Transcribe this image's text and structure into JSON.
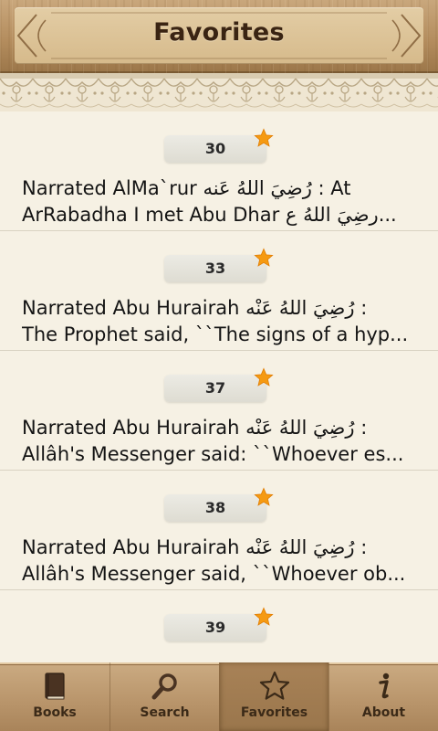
{
  "header": {
    "title": "Favorites"
  },
  "favorites": [
    {
      "number": "30",
      "line1": "Narrated AlMa`rur رُضِيَ اللهُ عَنه : At",
      "line2": "ArRabadha I met Abu Dhar رضِيَ اللهُ ع..."
    },
    {
      "number": "33",
      "line1": "Narrated Abu Hurairah رُضِيَ اللهُ عَنْه :",
      "line2": "The Prophet said, ``The signs of a hyp..."
    },
    {
      "number": "37",
      "line1": "Narrated Abu Hurairah رُضِيَ اللهُ عَنْه :",
      "line2": "Allâh's Messenger said: ``Whoever es..."
    },
    {
      "number": "38",
      "line1": "Narrated Abu Hurairah رُضِيَ اللهُ عَنْه :",
      "line2": "Allâh's Messenger said, ``Whoever ob..."
    },
    {
      "number": "39",
      "line1": "",
      "line2": ""
    }
  ],
  "icons": {
    "favorite_marker": "star-icon",
    "books": "book-icon",
    "search": "magnifier-icon",
    "favorites": "star-outline-icon",
    "about": "info-icon"
  },
  "colors": {
    "star": "#f59a12",
    "wood": "#b48d5e",
    "paper": "#f6f1e4",
    "title": "#3a2413"
  },
  "bottom_nav": {
    "active": "Favorites",
    "tabs": [
      {
        "label": "Books"
      },
      {
        "label": "Search"
      },
      {
        "label": "Favorites"
      },
      {
        "label": "About"
      }
    ]
  }
}
